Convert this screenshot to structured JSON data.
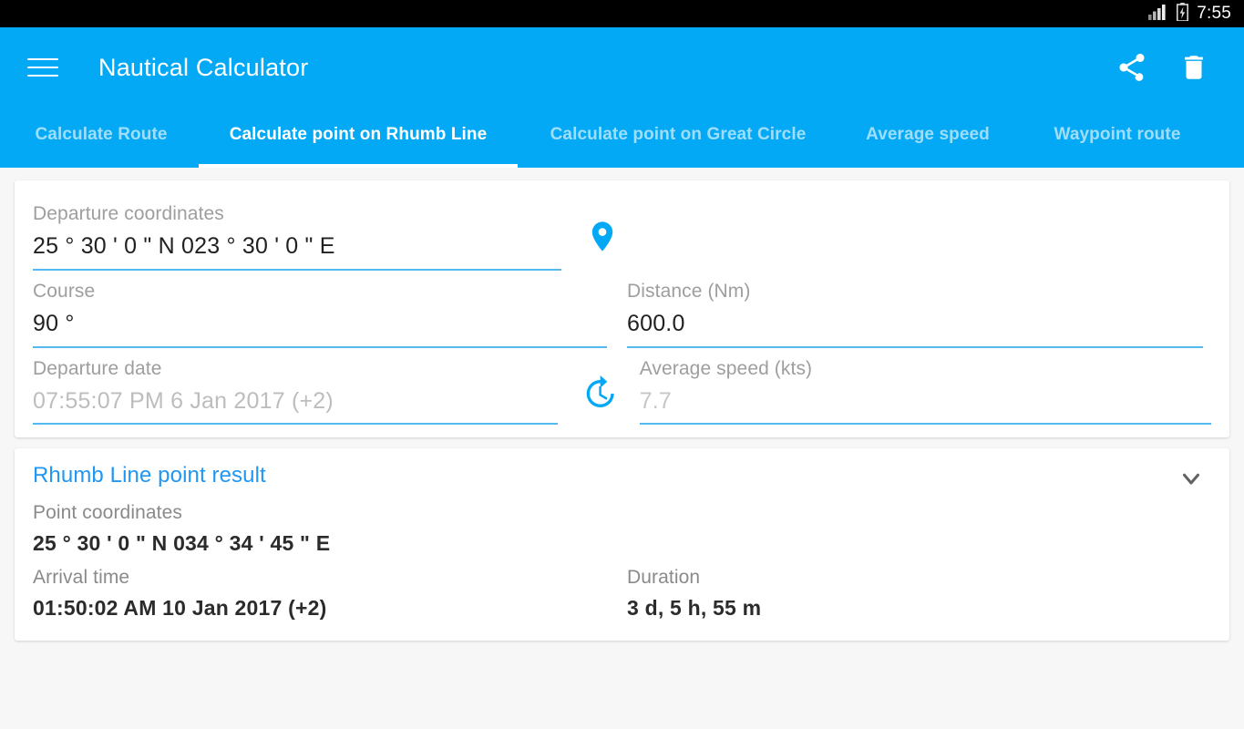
{
  "status_bar": {
    "time": "7:55",
    "signal_icon": "signal-bars-icon",
    "battery_icon": "battery-charging-icon"
  },
  "app_bar": {
    "title": "Nautical Calculator",
    "menu_icon": "hamburger-menu-icon",
    "actions": [
      {
        "name": "share-icon",
        "label": "Share"
      },
      {
        "name": "delete-icon",
        "label": "Delete"
      }
    ]
  },
  "tabs": [
    {
      "label": "Calculate Route",
      "active": false
    },
    {
      "label": "Calculate point on Rhumb Line",
      "active": true
    },
    {
      "label": "Calculate point on Great Circle",
      "active": false
    },
    {
      "label": "Average speed",
      "active": false
    },
    {
      "label": "Waypoint route",
      "active": false
    }
  ],
  "form": {
    "departure_coordinates": {
      "label": "Departure coordinates",
      "value": "25 ° 30 '  0 \" N 023 ° 30 '  0 \" E",
      "pin_icon": "map-pin-icon"
    },
    "course": {
      "label": "Course",
      "value": "90 °"
    },
    "distance": {
      "label": "Distance (Nm)",
      "value": "600.0"
    },
    "departure_date": {
      "label": "Departure date",
      "value": "07:55:07 PM 6 Jan 2017 (+2)",
      "clock_icon": "update-clock-icon"
    },
    "average_speed": {
      "label": "Average speed (kts)",
      "value": "7.7"
    }
  },
  "result": {
    "title": "Rhumb Line point result",
    "collapse_icon": "chevron-down-icon",
    "point_coordinates": {
      "label": "Point coordinates",
      "value": "25 ° 30 '   0 \" N 034 ° 34 '  45 \" E"
    },
    "arrival_time": {
      "label": "Arrival time",
      "value": "01:50:02 AM 10 Jan 2017 (+2)"
    },
    "duration": {
      "label": "Duration",
      "value": "3 d, 5 h, 55 m"
    }
  },
  "colors": {
    "accent": "#03a9f4",
    "result_title": "#2196f3",
    "underline": "#54b9ef",
    "page_background": "#f7f7f7",
    "status_bar": "#000000"
  }
}
